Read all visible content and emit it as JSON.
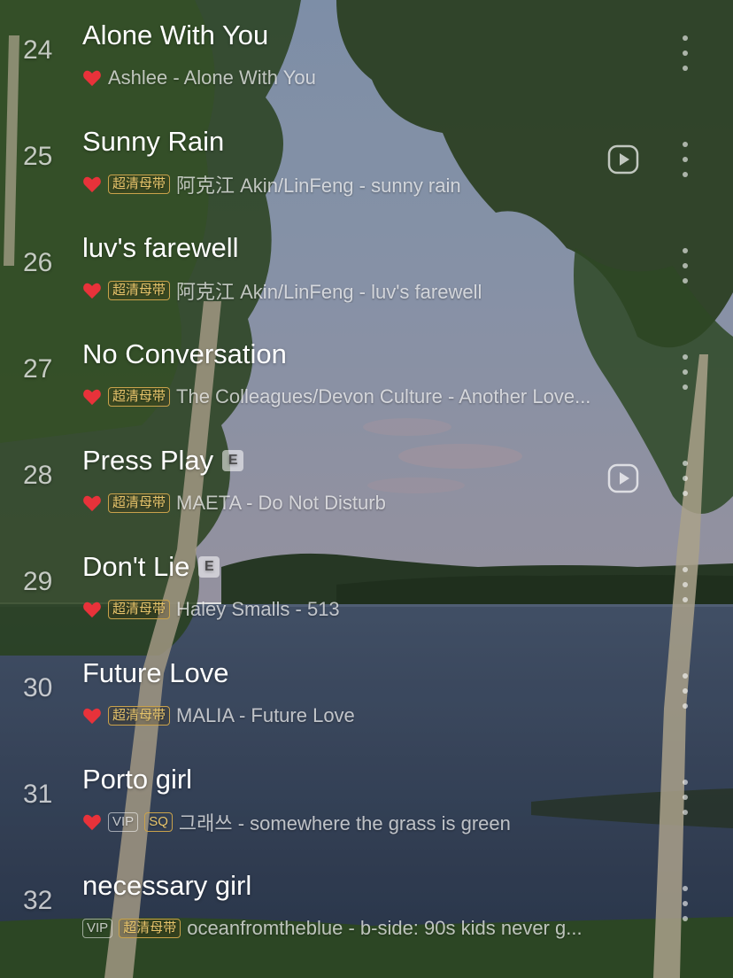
{
  "colors": {
    "heart": "#e8323a",
    "hq_tag": "#e7c46b",
    "sky_top": "#7f95b3",
    "lake": "#3a4b63",
    "foliage": "#2f4a22"
  },
  "tags": {
    "hq": "超清母带",
    "vip": "VIP",
    "sq": "SQ",
    "explicit": "E"
  },
  "icons": {
    "liked": "heart-icon",
    "mv": "play-video-icon",
    "more": "more-vertical-icon"
  },
  "songs": [
    {
      "num": "24",
      "title": "Alone With You",
      "artist": "Ashlee",
      "album": "Alone With You",
      "sep": " - "
    },
    {
      "num": "25",
      "title": "Sunny Rain",
      "artist": "阿克江 Akin/LinFeng",
      "album": "sunny rain",
      "sep": " - "
    },
    {
      "num": "26",
      "title": "luv's farewell",
      "artist": "阿克江 Akin/LinFeng",
      "album": "luv's farewell",
      "sep": " - "
    },
    {
      "num": "27",
      "title": "No Conversation",
      "artist": "The Colleagues/Devon Culture",
      "album": "Another Love...",
      "sep": " - "
    },
    {
      "num": "28",
      "title": "Press Play",
      "artist": "MAETA",
      "album": "Do Not Disturb",
      "sep": " - "
    },
    {
      "num": "29",
      "title": "Don't Lie",
      "artist": "Haley Smalls",
      "album": "513",
      "sep": " - "
    },
    {
      "num": "30",
      "title": "Future Love",
      "artist": "MALIA",
      "album": "Future Love",
      "sep": " - "
    },
    {
      "num": "31",
      "title": "Porto girl",
      "artist": "그래쓰",
      "album": "somewhere the grass is green",
      "sep": " - "
    },
    {
      "num": "32",
      "title": "necessary girl",
      "artist": "oceanfromtheblue",
      "album": "b-side: 90s kids never g...",
      "sep": " - "
    }
  ]
}
